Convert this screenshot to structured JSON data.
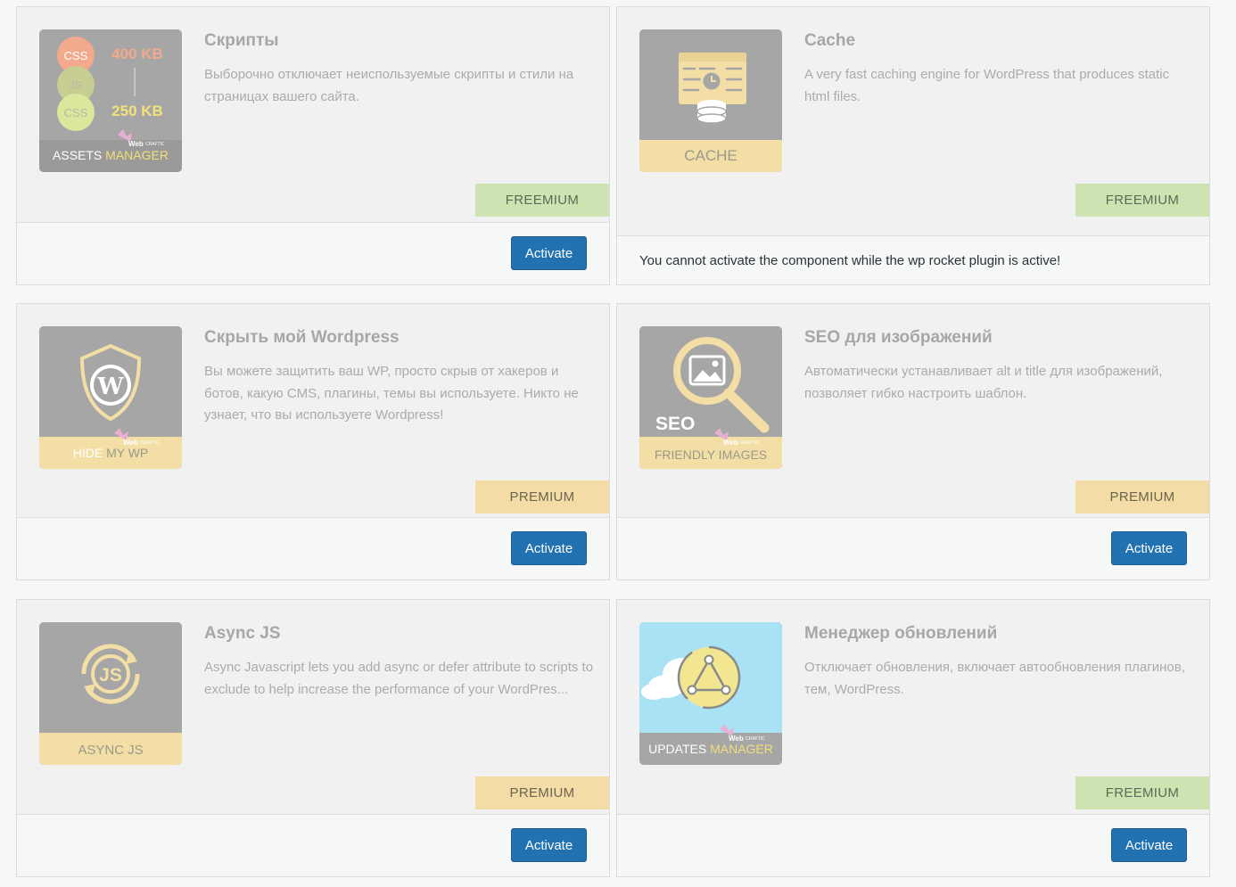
{
  "components": [
    {
      "title": "Скрипты",
      "description": "Выборочно отключает неиспользуемые скрипты и стили на страницах вашего сайта.",
      "badge": "FREEMIUM",
      "button": "Activate",
      "thumb": {
        "label_a": "ASSETS ",
        "label_b": "MANAGER",
        "css1": "CSS",
        "js": "JS",
        "css2": "CSS",
        "size1": "400 KB",
        "size2": "250 KB",
        "brand_a": "Web",
        "brand_b": "CRAFTIC"
      }
    },
    {
      "title": "Cache",
      "description": "A very fast caching engine for WordPress that produces static html files.",
      "badge": "FREEMIUM",
      "notice": "You cannot activate the component while the wp rocket plugin is active!",
      "thumb": {
        "label": "CACHE"
      }
    },
    {
      "title": "Скрыть мой Wordpress",
      "description": "Вы можете защитить ваш WP, просто скрыв от хакеров и ботов, какую CMS, плагины, темы вы используете. Никто не узнает, что вы используете Wordpress!",
      "badge": "PREMIUM",
      "button": "Activate",
      "thumb": {
        "label_a": "HIDE ",
        "label_b": "MY WP",
        "brand_a": "Web",
        "brand_b": "CRAFTIC"
      }
    },
    {
      "title": "SEO для изображений",
      "description": "Автоматически устанавливает alt и title для изображений, позволяет гибко настроить шаблон.",
      "badge": "PREMIUM",
      "button": "Activate",
      "thumb": {
        "seo": "SEO",
        "label": "FRIENDLY IMAGES",
        "brand_a": "Web",
        "brand_b": "CRAFTIC"
      }
    },
    {
      "title": "Async JS",
      "description": "Async Javascript lets you add async or defer attribute to scripts to exclude to help increase the performance of your WordPres...",
      "badge": "PREMIUM",
      "button": "Activate",
      "thumb": {
        "js": "JS",
        "label": "ASYNC JS"
      }
    },
    {
      "title": "Менеджер обновлений",
      "description": "Отключает обновления, включает автообновления плагинов, тем, WordPress.",
      "badge": "FREEMIUM",
      "button": "Activate",
      "thumb": {
        "label_a": "UPDATES ",
        "label_b": "MANAGER",
        "brand_a": "Web",
        "brand_b": "CRAFTIC"
      }
    }
  ],
  "colors": {
    "card_bg": "#f1f1f1",
    "footer_bg": "#f6f7f7",
    "button": "#2271b1",
    "freemium": "#cfe3b2",
    "premium": "#f4dca6",
    "thumb_gray": "#a6a6a6",
    "thumb_yellow": "#f3dea6"
  }
}
